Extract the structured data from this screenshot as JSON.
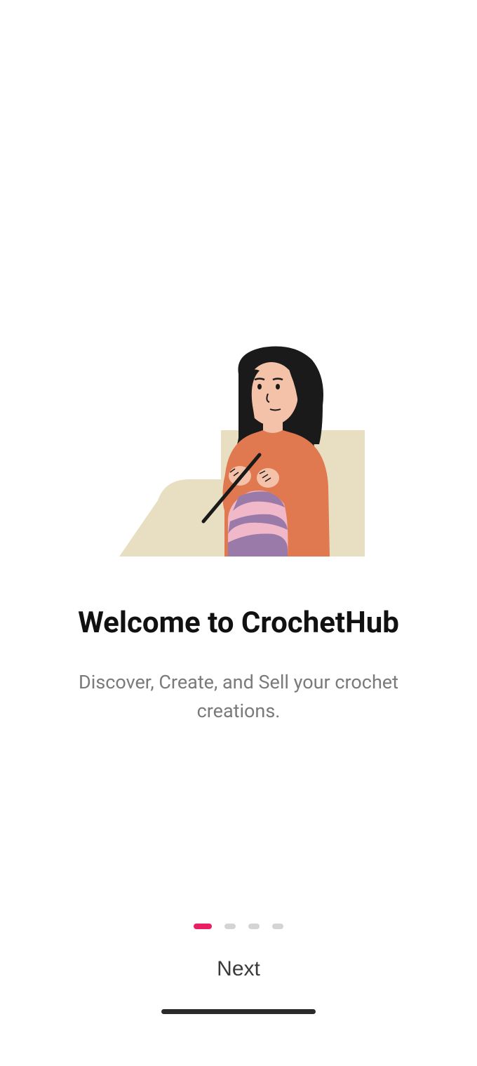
{
  "onboarding": {
    "title": "Welcome to CrochetHub",
    "subtitle": "Discover, Create, and Sell your crochet creations.",
    "next_label": "Next",
    "current_page": 0,
    "total_pages": 4
  }
}
